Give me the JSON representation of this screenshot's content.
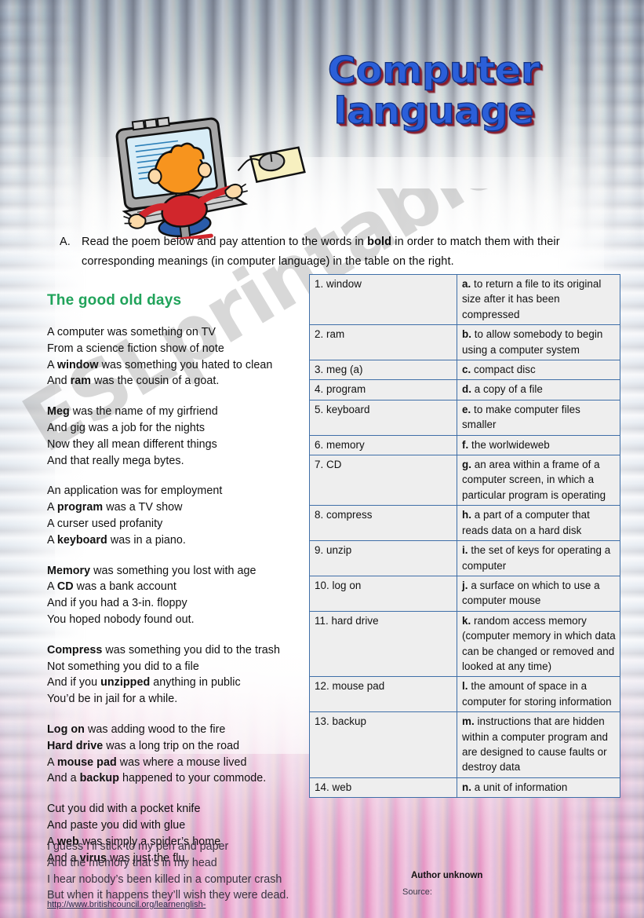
{
  "title": {
    "line1": "Computer",
    "line2": "language",
    "color_fill": "#2b5fd9",
    "color_shadow": "#8a1b2a"
  },
  "clipart": {
    "name": "boy-at-computer-clipart",
    "hair_color": "#f7941e",
    "shirt_color": "#d1262c",
    "chair_color": "#2a5caa",
    "monitor_color": "#9a9a9a"
  },
  "instruction": {
    "letter": "A.",
    "text": "Read  the poem below and pay attention to the words in ",
    "bold_word": "bold",
    "text2": " in order to match them with their corresponding meanings  (in  computer language) in the table on the right."
  },
  "poem": {
    "heading": "The good old days",
    "heading_color": "#20a35a",
    "stanzas": [
      {
        "lines": [
          [
            {
              "t": "A computer was something on TV"
            }
          ],
          [
            {
              "t": "From a science fiction show of note"
            }
          ],
          [
            {
              "t": "A "
            },
            {
              "t": "window",
              "b": true
            },
            {
              "t": " was something you hated to clean"
            }
          ],
          [
            {
              "t": "And "
            },
            {
              "t": "ram",
              "b": true
            },
            {
              "t": " was the cousin of a goat."
            }
          ]
        ]
      },
      {
        "lines": [
          [
            {
              "t": "Meg",
              "b": true
            },
            {
              "t": " was the name of my girfriend"
            }
          ],
          [
            {
              "t": "And gig was a job for the nights"
            }
          ],
          [
            {
              "t": "Now they all mean different things"
            }
          ],
          [
            {
              "t": "And that really mega bytes."
            }
          ]
        ]
      },
      {
        "lines": [
          [
            {
              "t": "An  application was for employment"
            }
          ],
          [
            {
              "t": "A "
            },
            {
              "t": "program",
              "b": true
            },
            {
              "t": " was a TV show"
            }
          ],
          [
            {
              "t": "A curser used profanity"
            }
          ],
          [
            {
              "t": "A "
            },
            {
              "t": "keyboard",
              "b": true
            },
            {
              "t": " was in a piano."
            }
          ]
        ]
      },
      {
        "lines": [
          [
            {
              "t": "Memory",
              "b": true
            },
            {
              "t": " was something you lost with age"
            }
          ],
          [
            {
              "t": "A "
            },
            {
              "t": "CD",
              "b": true
            },
            {
              "t": " was a bank account"
            }
          ],
          [
            {
              "t": "And if you had a 3-in. floppy"
            }
          ],
          [
            {
              "t": "You hoped nobody found out."
            }
          ]
        ]
      },
      {
        "lines": [
          [
            {
              "t": "Compress",
              "b": true
            },
            {
              "t": " was something you did to the trash"
            }
          ],
          [
            {
              "t": "Not something you did to a file"
            }
          ],
          [
            {
              "t": "And if you "
            },
            {
              "t": "unzipped",
              "b": true
            },
            {
              "t": " anything in public"
            }
          ],
          [
            {
              "t": "You’d be in jail for a while."
            }
          ]
        ]
      },
      {
        "lines": [
          [
            {
              "t": "Log on",
              "b": true
            },
            {
              "t": " was adding wood to the fire"
            }
          ],
          [
            {
              "t": "Hard drive",
              "b": true
            },
            {
              "t": " was a long trip on the road"
            }
          ],
          [
            {
              "t": "A "
            },
            {
              "t": "mouse pad",
              "b": true
            },
            {
              "t": " was where a mouse lived"
            }
          ],
          [
            {
              "t": "And a "
            },
            {
              "t": "backup",
              "b": true
            },
            {
              "t": " happened to your commode."
            }
          ]
        ]
      },
      {
        "lines": [
          [
            {
              "t": "Cut you did with a pocket knife"
            }
          ],
          [
            {
              "t": "And paste you did with glue"
            }
          ],
          [
            {
              "t": "A "
            },
            {
              "t": "web",
              "b": true
            },
            {
              "t": " was simply a spider’s home"
            }
          ],
          [
            {
              "t": "And a "
            },
            {
              "t": "virus",
              "b": true
            },
            {
              "t": " was just the flu."
            }
          ]
        ]
      }
    ],
    "last_stanza": [
      "I guess I’ll stick to my pen and  paper",
      "And the memory that’s in my head",
      "I hear nobody’s been killed in a computer crash",
      "But when it happens they’ll wish they were dead."
    ],
    "url": "http://www.britishcouncil.org/learnenglish-"
  },
  "table": {
    "border_color": "#3f6fa8",
    "cell_bg": "#eeeeee",
    "rows": [
      {
        "word": "1.  window",
        "letter": "a.",
        "def": " to return a file to its original size after it has been compressed"
      },
      {
        "word": "2. ram",
        "letter": "b.",
        "def": " to allow somebody to begin using a computer system"
      },
      {
        "word": "3. meg (a)",
        "letter": "c.",
        "def": " compact disc"
      },
      {
        "word": "4. program",
        "letter": "d.",
        "def": " a copy of a file"
      },
      {
        "word": "5. keyboard",
        "letter": "e.",
        "def": " to make computer files smaller"
      },
      {
        "word": "6. memory",
        "letter": "f.",
        "def": " the worlwideweb"
      },
      {
        "word": "7. CD",
        "letter": "g.",
        "def": " an area within a frame of a computer screen, in which a particular program is operating"
      },
      {
        "word": "8. compress",
        "letter": "h.",
        "def": " a part  of a computer that reads data on a hard disk"
      },
      {
        "word": "9. unzip",
        "letter": "i.",
        "def": " the set of keys for operating a computer"
      },
      {
        "word": "10. log on",
        "letter": "j.",
        "def": " a surface on which to use a computer mouse"
      },
      {
        "word": "11. hard drive",
        "letter": "k.",
        "def": " random access memory (computer memory in which data can be changed or removed and looked at any time)"
      },
      {
        "word": "12. mouse pad",
        "letter": "l.",
        "def": " the amount of space in a computer for storing information"
      },
      {
        "word": "13. backup",
        "letter": "m.",
        "def": " instructions that are hidden within a computer program and are designed to cause faults or destroy data"
      },
      {
        "word": "14. web",
        "letter": "n.",
        "def": " a unit of information"
      }
    ]
  },
  "footer": {
    "author": "Author unknown",
    "source_label": "Source:"
  },
  "watermark": {
    "text": "ESLprintables.com"
  }
}
